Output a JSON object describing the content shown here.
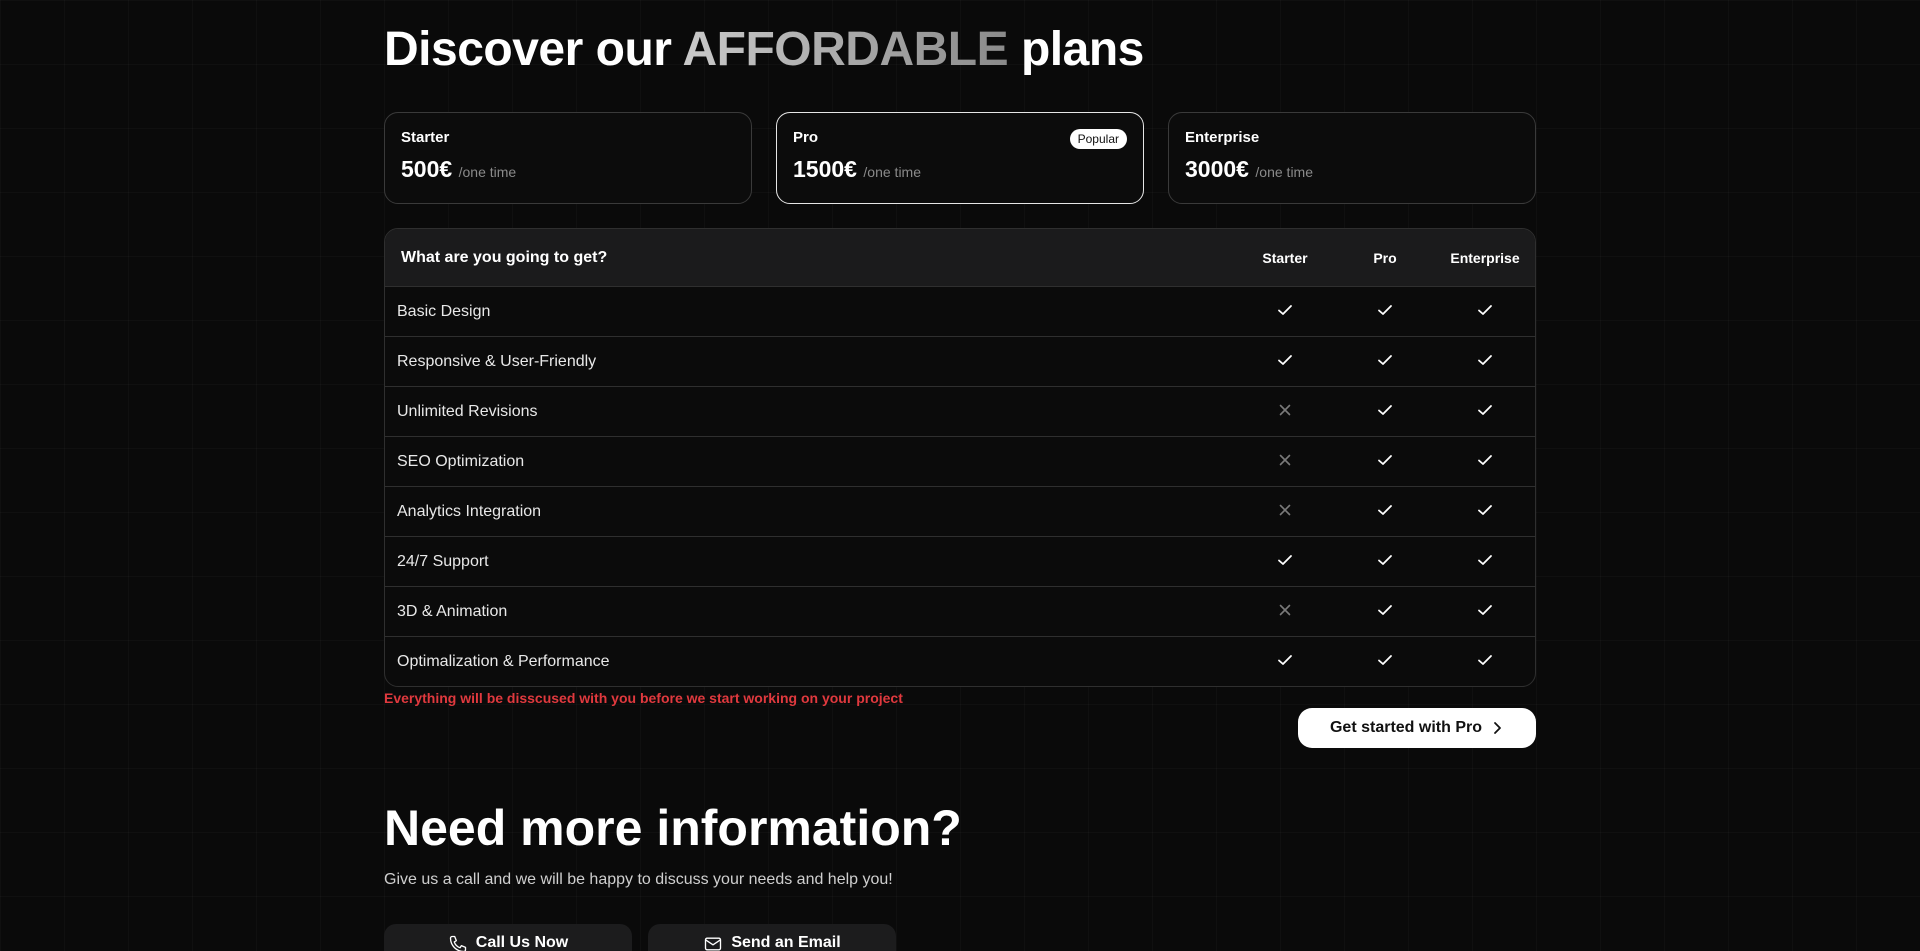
{
  "pricing": {
    "heading_pre": "Discover our",
    "heading_highlight": "AFFORDABLE",
    "heading_post": "plans",
    "plans": [
      {
        "name": "Starter",
        "price": "500€",
        "period": "/one time"
      },
      {
        "name": "Pro",
        "price": "1500€",
        "period": "/one time",
        "badge": "Popular"
      },
      {
        "name": "Enterprise",
        "price": "3000€",
        "period": "/one time"
      }
    ]
  },
  "table": {
    "header": {
      "feature": "What are you going to get?",
      "starter": "Starter",
      "pro": "Pro",
      "enterprise": "Enterprise"
    },
    "rows": [
      {
        "feature": "Basic Design",
        "starter": true,
        "pro": true,
        "enterprise": true
      },
      {
        "feature": "Responsive & User-Friendly",
        "starter": true,
        "pro": true,
        "enterprise": true
      },
      {
        "feature": "Unlimited Revisions",
        "starter": false,
        "pro": true,
        "enterprise": true
      },
      {
        "feature": "SEO Optimization",
        "starter": false,
        "pro": true,
        "enterprise": true
      },
      {
        "feature": "Analytics Integration",
        "starter": false,
        "pro": true,
        "enterprise": true
      },
      {
        "feature": "24/7 Support",
        "starter": true,
        "pro": true,
        "enterprise": true
      },
      {
        "feature": "3D & Animation",
        "starter": false,
        "pro": true,
        "enterprise": true
      },
      {
        "feature": "Optimalization & Performance",
        "starter": true,
        "pro": true,
        "enterprise": true
      }
    ]
  },
  "note": "Everything will be disscused with you before we start working on your project",
  "cta": {
    "label": "Get started with Pro"
  },
  "info": {
    "heading": "Need more information?",
    "subtitle": "Give us a call and we will be happy to discuss your needs and help you!",
    "call_label": "Call Us Now",
    "email_label": "Send an Email"
  },
  "colors": {
    "background": "#0a0a0a",
    "note": "#e0393e",
    "check": "#ffffff",
    "cross": "#7a7a7a"
  },
  "icons": {
    "included": "check-icon",
    "excluded": "cross-icon",
    "cta": "chevron-right-icon",
    "call": "phone-icon",
    "email": "mail-icon"
  }
}
